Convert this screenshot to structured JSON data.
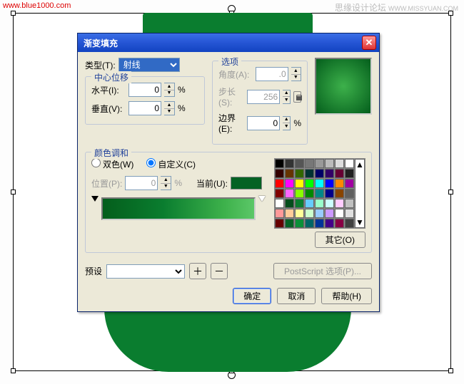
{
  "watermark": {
    "left": "www.blue1000.com",
    "right_a": "思缘设计论坛",
    "right_b": "WWW.MISSYUAN.COM"
  },
  "dialog": {
    "title": "渐变填充",
    "type_label": "类型(T):",
    "type_value": "射线",
    "center": {
      "legend": "中心位移",
      "h_label": "水平(I):",
      "h_value": "0",
      "h_unit": "%",
      "v_label": "垂直(V):",
      "v_value": "0",
      "v_unit": "%"
    },
    "options": {
      "legend": "选项",
      "angle_label": "角度(A):",
      "angle_value": ".0",
      "steps_label": "步长(S):",
      "steps_value": "256",
      "edge_label": "边界(E):",
      "edge_value": "0",
      "edge_unit": "%"
    },
    "harmony": {
      "legend": "颜色调和",
      "twocolor": "双色(W)",
      "custom": "自定义(C)",
      "custom_checked": true,
      "pos_label": "位置(P):",
      "pos_value": "0",
      "pos_unit": "%",
      "current_label": "当前(U):",
      "current_color": "#046224"
    },
    "palette": {
      "colors": [
        "#000000",
        "#333333",
        "#555555",
        "#777777",
        "#999999",
        "#bbbbbb",
        "#dddddd",
        "#ffffff",
        "#330000",
        "#663300",
        "#336600",
        "#003333",
        "#000066",
        "#330066",
        "#660033",
        "#202020",
        "#ff0000",
        "#ff00ff",
        "#ffff00",
        "#00ff00",
        "#00ffff",
        "#0000ff",
        "#ff8800",
        "#a000a0",
        "#800000",
        "#ff66ff",
        "#88ff00",
        "#008800",
        "#008888",
        "#000088",
        "#884400",
        "#606060",
        "#ffffff",
        "#044d1c",
        "#0a7d2f",
        "#66ccff",
        "#99ffcc",
        "#ccffff",
        "#ffccff",
        "#c0c0c0",
        "#ff9999",
        "#ffcc99",
        "#ffff99",
        "#ccffcc",
        "#99ccff",
        "#cc99ff",
        "#ffffff",
        "#e0e0e0",
        "#660000",
        "#046224",
        "#0a9038",
        "#006666",
        "#003399",
        "#440088",
        "#880044",
        "#404040"
      ],
      "other_btn": "其它(O)"
    },
    "preset_label": "预设",
    "preset_value": "",
    "ps_btn": "PostScript 选项(P)...",
    "ok": "确定",
    "cancel": "取消",
    "help": "帮助(H)"
  }
}
